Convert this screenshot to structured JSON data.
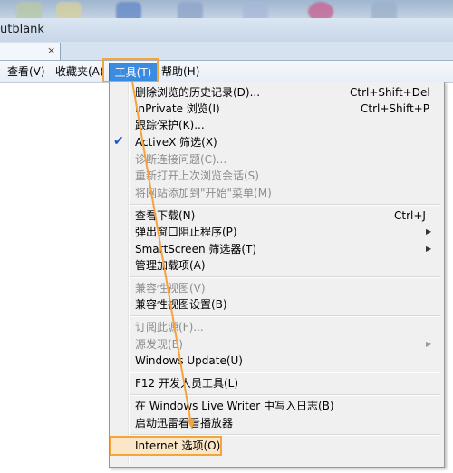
{
  "title": "utblank",
  "tab": {
    "close_glyph": "×"
  },
  "menubar": {
    "view": "查看(V)",
    "favorites": "收藏夹(A)",
    "tools": "工具(T)",
    "help": "帮助(H)"
  },
  "menu": {
    "items": [
      {
        "label": "删除浏览的历史记录(D)...",
        "shortcut": "Ctrl+Shift+Del"
      },
      {
        "label": "InPrivate 浏览(I)",
        "shortcut": "Ctrl+Shift+P"
      },
      {
        "label": "跟踪保护(K)..."
      },
      {
        "label": "ActiveX 筛选(X)",
        "checked": true
      },
      {
        "label": "诊断连接问题(C)...",
        "disabled": true
      },
      {
        "label": "重新打开上次浏览会话(S)",
        "disabled": true
      },
      {
        "label": "将网站添加到\"开始\"菜单(M)",
        "disabled": true
      },
      {
        "label": "查看下载(N)",
        "shortcut": "Ctrl+J"
      },
      {
        "label": "弹出窗口阻止程序(P)"
      },
      {
        "label": "SmartScreen 筛选器(T)"
      },
      {
        "label": "管理加载项(A)"
      },
      {
        "label": "兼容性视图(V)",
        "disabled": true
      },
      {
        "label": "兼容性视图设置(B)"
      },
      {
        "label": "订阅此源(F)...",
        "disabled": true
      },
      {
        "label": "源发现(E)",
        "disabled": true
      },
      {
        "label": "Windows Update(U)"
      },
      {
        "label": "F12 开发人员工具(L)"
      },
      {
        "label": "在 Windows Live Writer 中写入日志(B)"
      },
      {
        "label": "启动迅雷看看播放器"
      },
      {
        "label": "Internet 选项(O)"
      }
    ],
    "check_glyph": "✔",
    "submenu_glyph": "▶"
  },
  "colors": {
    "highlight": "#3b8be0",
    "annotation": "#f5a33b"
  }
}
